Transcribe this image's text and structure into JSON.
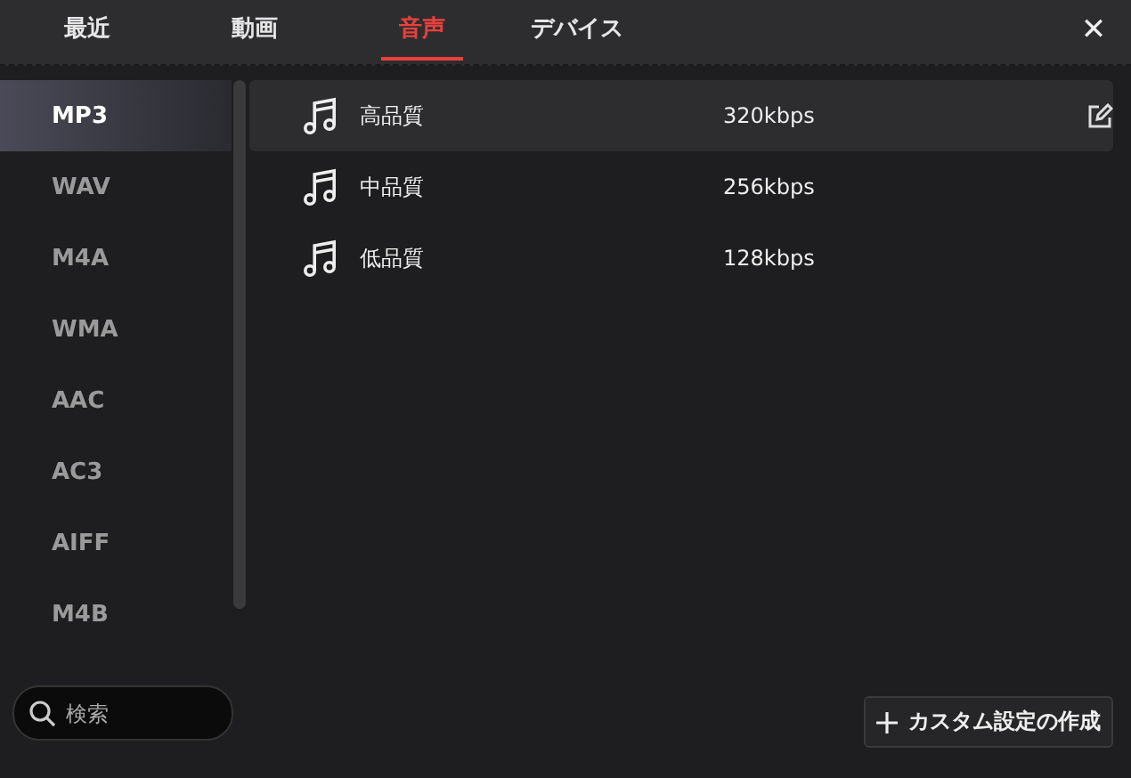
{
  "tabs": [
    {
      "label": "最近",
      "selected": false
    },
    {
      "label": "動画",
      "selected": false
    },
    {
      "label": "音声",
      "selected": true
    },
    {
      "label": "デバイス",
      "selected": false
    }
  ],
  "close": {
    "label": "✕"
  },
  "formats": [
    {
      "label": "MP3",
      "selected": true
    },
    {
      "label": "WAV",
      "selected": false
    },
    {
      "label": "M4A",
      "selected": false
    },
    {
      "label": "WMA",
      "selected": false
    },
    {
      "label": "AAC",
      "selected": false
    },
    {
      "label": "AC3",
      "selected": false
    },
    {
      "label": "AIFF",
      "selected": false
    },
    {
      "label": "M4B",
      "selected": false
    }
  ],
  "search": {
    "placeholder": "検索"
  },
  "presets": [
    {
      "name": "高品質",
      "bitrate": "320kbps",
      "selected": true
    },
    {
      "name": "中品質",
      "bitrate": "256kbps",
      "selected": false
    },
    {
      "name": "低品質",
      "bitrate": "128kbps",
      "selected": false
    }
  ],
  "create_button": {
    "label": "カスタム設定の作成"
  }
}
